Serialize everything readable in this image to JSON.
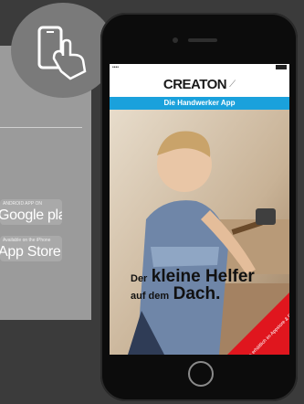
{
  "left": {
    "stores": [
      {
        "small": "ANDROID APP ON",
        "big": "Google play"
      },
      {
        "small": "Available on the iPhone",
        "big": "App Store"
      }
    ]
  },
  "phone": {
    "brand": "CREATON",
    "subtitle": "Die Handwerker App",
    "headline_line1_small": "Der",
    "headline_line1_big": "kleine Helfer",
    "headline_line2_small": "auf dem",
    "headline_line2_big": "Dach.",
    "ribbon": "Kostenlos erhältlich im Appstore & Playstore!"
  },
  "colors": {
    "accent_blue": "#1aa1dc",
    "ribbon_red": "#e0161e",
    "panel_gray": "#9b9b9b",
    "background": "#3b3b3b"
  }
}
